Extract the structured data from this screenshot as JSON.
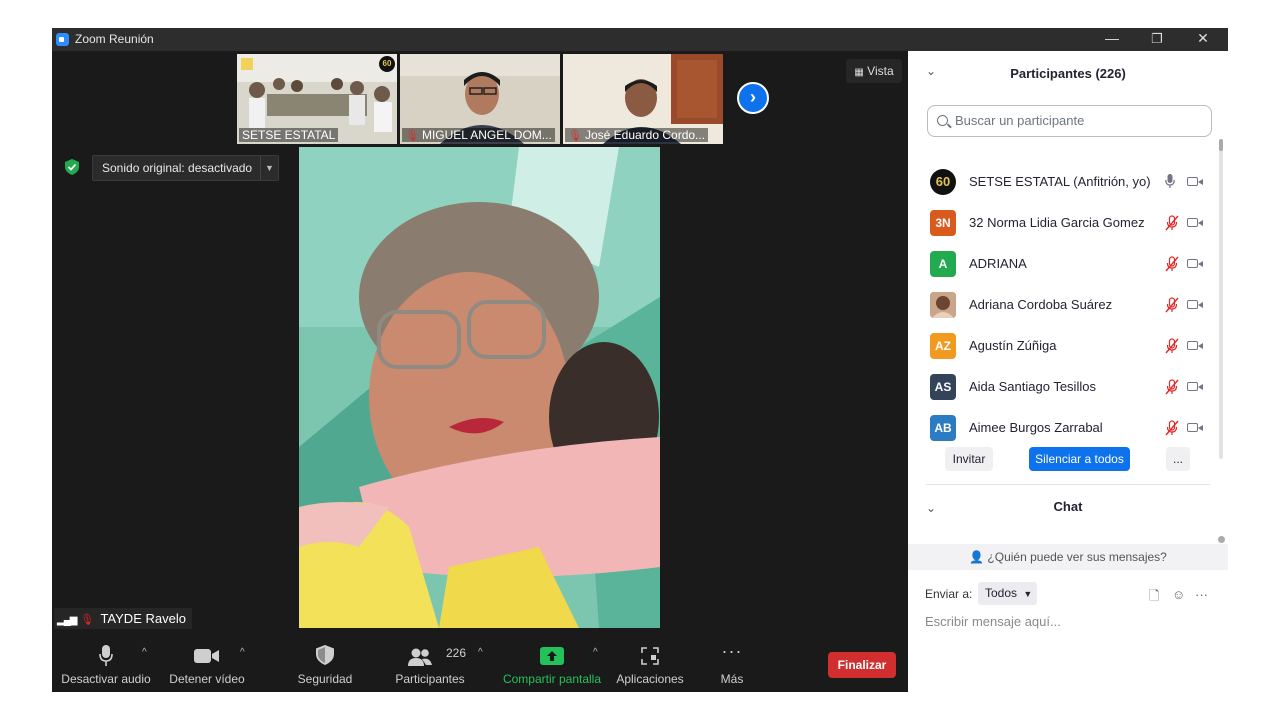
{
  "window": {
    "title": "Zoom Reunión",
    "controls": {
      "minimize": "—",
      "restore": "❐",
      "close": "✕"
    }
  },
  "video": {
    "thumbnails": [
      {
        "label": "SETSE ESTATAL",
        "muted": false
      },
      {
        "label": "MIGUEL ANGEL DOM...",
        "muted": true
      },
      {
        "label": "José Eduardo Cordo...",
        "muted": true
      }
    ],
    "view_button": "Vista",
    "original_sound": "Sonido original: desactivado",
    "active_speaker": "TAYDE Ravelo",
    "thumb_badge": "60"
  },
  "toolbar": {
    "mute": "Desactivar audio",
    "video": "Detener vídeo",
    "security": "Seguridad",
    "participants": "Participantes",
    "participants_count": "226",
    "share": "Compartir pantalla",
    "apps": "Aplicaciones",
    "more": "Más",
    "end": "Finalizar"
  },
  "panel": {
    "participants_title": "Participantes (226)",
    "search_placeholder": "Buscar un participante",
    "participants": [
      {
        "initials": "60",
        "name": "SETSE ESTATAL (Anfitrión, yo)",
        "color": "#111111",
        "mic_on": true
      },
      {
        "initials": "3N",
        "name": "32 Norma Lidia Garcia Gomez",
        "color": "#d85a1c",
        "mic_on": false
      },
      {
        "initials": "A",
        "name": "ADRIANA",
        "color": "#23a94f",
        "mic_on": false
      },
      {
        "initials": "",
        "name": "Adriana Cordoba Suárez",
        "color": "#b5785a",
        "mic_on": false
      },
      {
        "initials": "AZ",
        "name": "Agustín Zúñiga",
        "color": "#f19a1f",
        "mic_on": false
      },
      {
        "initials": "AS",
        "name": "Aida Santiago Tesillos",
        "color": "#33435a",
        "mic_on": false
      },
      {
        "initials": "AB",
        "name": "Aimee Burgos Zarrabal",
        "color": "#2b7cc2",
        "mic_on": false
      }
    ],
    "invite": "Invitar",
    "mute_all": "Silenciar a todos",
    "more": "...",
    "chat_title": "Chat",
    "who_can_see": "¿Quién puede ver sus mensajes?",
    "send_to_label": "Enviar a:",
    "send_to_value": "Todos",
    "chat_placeholder": "Escribir mensaje aquí..."
  }
}
